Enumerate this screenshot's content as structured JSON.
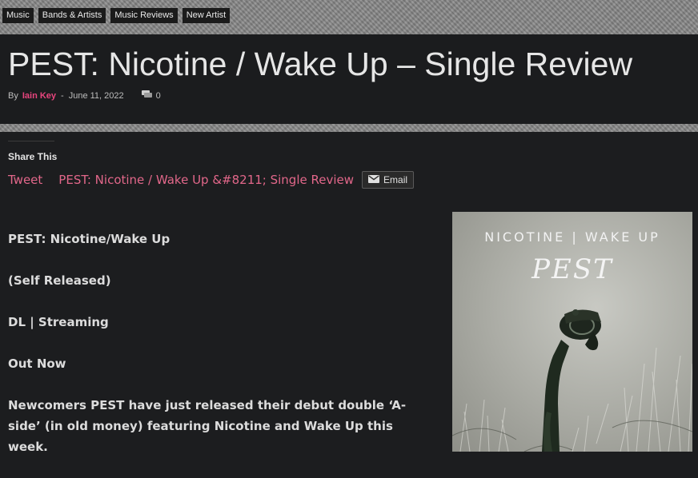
{
  "categories": [
    "Music",
    "Bands & Artists",
    "Music Reviews",
    "New Artist"
  ],
  "article": {
    "title": "PEST: Nicotine / Wake Up – Single Review",
    "by_label": "By",
    "author": "Iain Key",
    "separator": "-",
    "date": "June 11, 2022",
    "comment_count": "0"
  },
  "share": {
    "heading": "Share This",
    "tweet_label": "Tweet",
    "share_title_link": "PEST: Nicotine / Wake Up &#8211; Single Review",
    "email_label": "Email"
  },
  "body": {
    "paragraphs": [
      "PEST: Nicotine/Wake Up",
      "(Self Released)",
      "DL | Streaming",
      "Out Now",
      "Newcomers PEST have just released their debut double ‘A-side’ (in old money) featuring Nicotine and Wake Up this week."
    ]
  },
  "album_art": {
    "top_text": "NICOTINE | WAKE UP",
    "band_logo": "PEST",
    "icons": [
      "hand-holding-gas-mask"
    ]
  },
  "colors": {
    "accent_pink": "#e8457e",
    "link_pink": "#e2678a",
    "background": "#1c1d1f"
  }
}
